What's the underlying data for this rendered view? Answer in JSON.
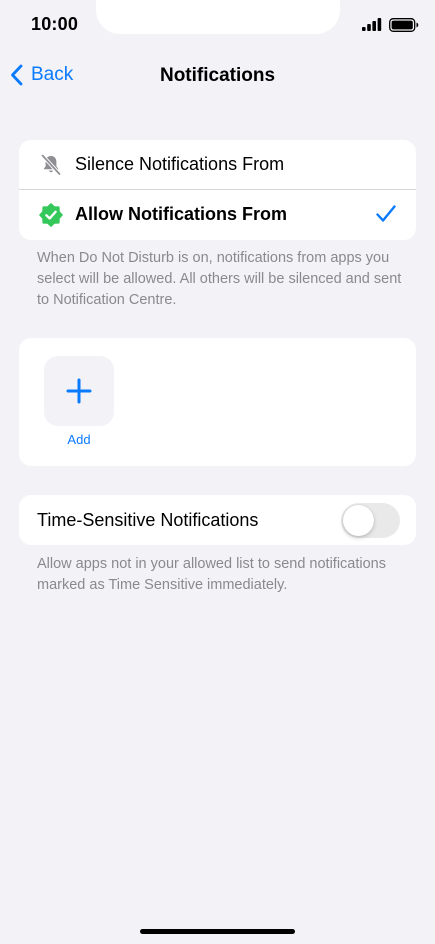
{
  "status_bar": {
    "time": "10:00"
  },
  "nav": {
    "back_label": "Back",
    "title": "Notifications"
  },
  "mode": {
    "options": [
      {
        "label": "Silence Notifications From",
        "icon": "bell-slash-icon",
        "selected": false
      },
      {
        "label": "Allow Notifications From",
        "icon": "checkmark-seal-icon",
        "selected": true
      }
    ],
    "footnote": "When Do Not Disturb is on, notifications from apps you select will be allowed. All others will be silenced and sent to Notification Centre."
  },
  "apps": {
    "add_label": "Add"
  },
  "time_sensitive": {
    "label": "Time-Sensitive Notifications",
    "enabled": false,
    "footnote": "Allow apps not in your allowed list to send notifications marked as Time Sensitive immediately."
  },
  "colors": {
    "accent": "#0a7aff",
    "allow_icon": "#34c759",
    "background": "#f2f2f7"
  }
}
